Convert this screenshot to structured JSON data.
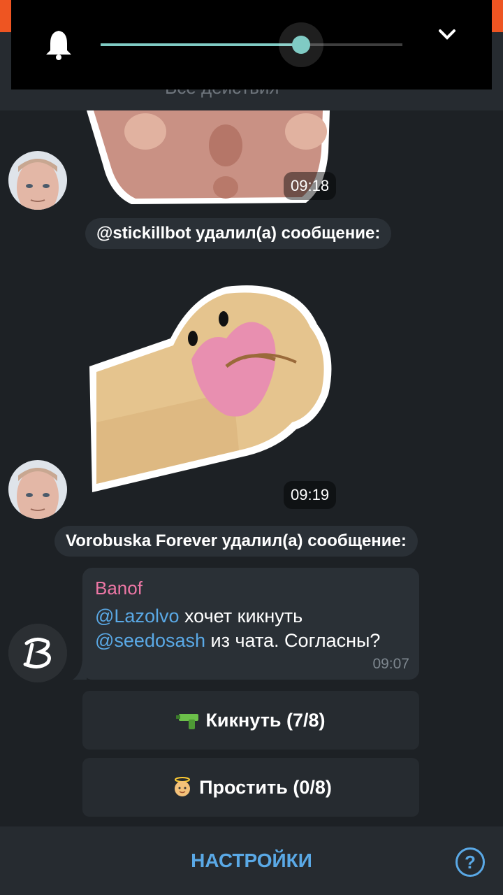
{
  "header": {
    "subtitle": "Все действия"
  },
  "volume": {
    "level": 0.665,
    "icons": [
      "bell-icon",
      "chevron-down-icon"
    ]
  },
  "messages": [
    {
      "type": "sticker",
      "time": "09:18"
    },
    {
      "type": "service",
      "text": "@stickillbot удалил(а) сообщение:"
    },
    {
      "type": "sticker",
      "time": "09:19"
    },
    {
      "type": "service",
      "text": "Vorobuska Forever удалил(а) сообщение:"
    },
    {
      "type": "text",
      "author": "Banof",
      "mention1": "@Lazolvo",
      "text1": " хочет кикнуть",
      "mention2": "@seedosash",
      "text2": " из чата. Согласны?",
      "time": "09:07"
    }
  ],
  "buttons": [
    {
      "label": "Кикнуть (7/8)",
      "icon": "water-gun-icon"
    },
    {
      "label": "Простить (0/8)",
      "icon": "angel-baby-icon"
    }
  ],
  "bottom_bar": {
    "label": "НАСТРОЙКИ",
    "help": "?"
  },
  "colors": {
    "accent": "#5aa9e6",
    "author": "#ee77a6",
    "slider": "#80cbc4",
    "brand_orange": "#ee5522"
  }
}
